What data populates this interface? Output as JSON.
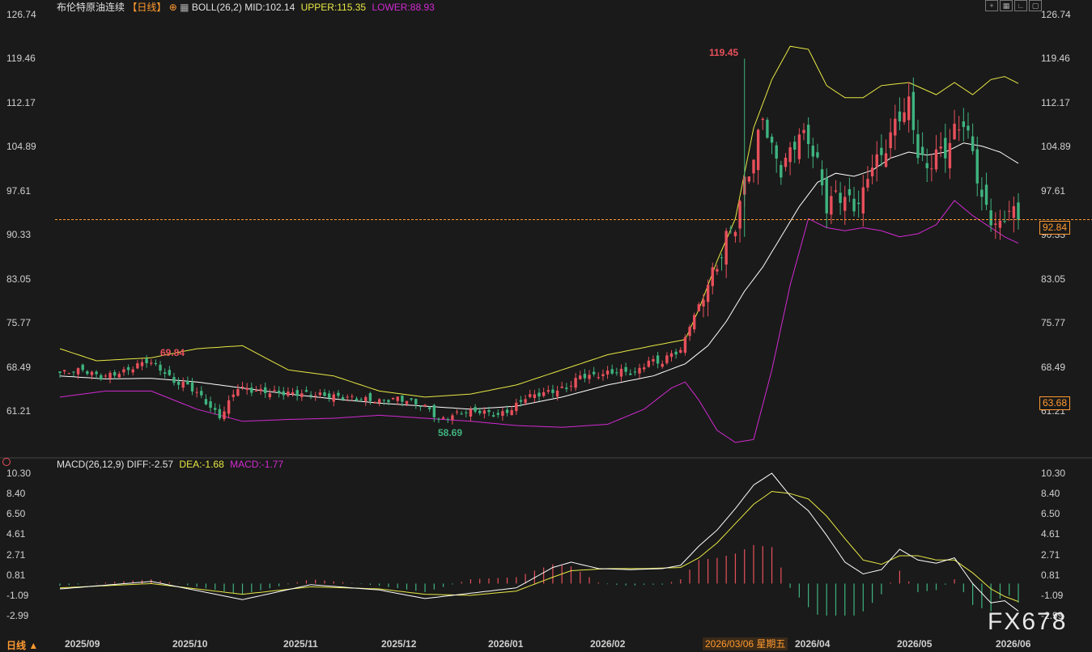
{
  "header": {
    "symbol": "布伦特原油连续",
    "period": "【日线】",
    "indicator": "BOLL(26,2)",
    "mid": "MID:102.14",
    "upper": "UPPER:115.35",
    "lower": "LOWER:88.93"
  },
  "macd_header": {
    "name": "MACD(26,12,9)",
    "diff": "DIFF:-2.57",
    "dea": "DEA:-1.68",
    "macd": "MACD:-1.77"
  },
  "bottom_label": "日线 ▲",
  "watermark": "FX678",
  "current_price_label": "92.84",
  "crosshair_price_label": "63.68",
  "crosshair_date_label": "2026/03/06 星期五",
  "annotations": {
    "high": "119.45",
    "mid_high": "69.84",
    "low": "58.69"
  },
  "colors": {
    "up": "#e8505b",
    "down": "#3fb37f",
    "upper": "#e8e845",
    "mid": "#ffffff",
    "lower": "#d22ad2",
    "dea": "#e8e845",
    "diff": "#ffffff",
    "price_line": "#ff9a30"
  },
  "price_ticks": [
    "126.74",
    "119.46",
    "112.17",
    "104.89",
    "97.61",
    "90.33",
    "83.05",
    "75.77",
    "68.49",
    "61.21"
  ],
  "macd_ticks": [
    "10.30",
    "8.40",
    "6.50",
    "4.61",
    "2.71",
    "0.81",
    "-1.09",
    "-2.99"
  ],
  "x_labels": [
    "2025/09",
    "2025/10",
    "2025/11",
    "2025/12",
    "2026/01",
    "2026/02",
    "2026/04",
    "2026/05",
    "2026/06"
  ],
  "chart_data": [
    {
      "type": "candlestick",
      "title": "布伦特原油连续",
      "ylim": [
        54.0,
        126.74
      ],
      "current_price": 92.84,
      "annotations": {
        "high": 119.45,
        "marked_high": 69.84,
        "low": 58.69
      },
      "close_path": [
        [
          0,
          67.5
        ],
        [
          5,
          68.0
        ],
        [
          9,
          66.8
        ],
        [
          14,
          67.7
        ],
        [
          19,
          69.5
        ],
        [
          22,
          68.2
        ],
        [
          25,
          66.0
        ],
        [
          28,
          65.5
        ],
        [
          31,
          63.5
        ],
        [
          33,
          61.8
        ],
        [
          35,
          60.2
        ],
        [
          37,
          62.6
        ],
        [
          39,
          65.2
        ],
        [
          42,
          64.6
        ],
        [
          48,
          64.2
        ],
        [
          55,
          64.0
        ],
        [
          62,
          63.5
        ],
        [
          66,
          63.2
        ],
        [
          70,
          62.8
        ],
        [
          74,
          63.3
        ],
        [
          78,
          62.5
        ],
        [
          81,
          61.5
        ],
        [
          83,
          59.6
        ],
        [
          85,
          60.2
        ],
        [
          88,
          61.0
        ],
        [
          92,
          61.2
        ],
        [
          96,
          60.5
        ],
        [
          99,
          61.5
        ],
        [
          102,
          63.5
        ],
        [
          105,
          64.0
        ],
        [
          108,
          64.5
        ],
        [
          111,
          65.0
        ],
        [
          114,
          67.0
        ],
        [
          117,
          67.0
        ],
        [
          120,
          67.5
        ],
        [
          123,
          67.8
        ],
        [
          126,
          67.4
        ],
        [
          129,
          69.5
        ],
        [
          132,
          69.2
        ],
        [
          134,
          70.8
        ],
        [
          136,
          71.0
        ],
        [
          138,
          75.5
        ],
        [
          140,
          78.5
        ],
        [
          142,
          82.5
        ],
        [
          144,
          85.0
        ],
        [
          146,
          90.0
        ],
        [
          148,
          92.0
        ],
        [
          150,
          99.0
        ],
        [
          152,
          103.0
        ],
        [
          154,
          110.0
        ],
        [
          156,
          104.5
        ],
        [
          158,
          101.0
        ],
        [
          160,
          104.0
        ],
        [
          162,
          107.0
        ],
        [
          164,
          106.0
        ],
        [
          166,
          102.0
        ],
        [
          168,
          95.0
        ],
        [
          170,
          97.0
        ],
        [
          172,
          96.5
        ],
        [
          174,
          95.0
        ],
        [
          176,
          97.0
        ],
        [
          178,
          102.5
        ],
        [
          180,
          103.0
        ],
        [
          182,
          107.0
        ],
        [
          184,
          110.0
        ],
        [
          186,
          112.0
        ],
        [
          188,
          104.0
        ],
        [
          190,
          101.0
        ],
        [
          192,
          104.0
        ],
        [
          194,
          104.0
        ],
        [
          196,
          107.5
        ],
        [
          198,
          109.0
        ],
        [
          200,
          104.0
        ],
        [
          202,
          96.0
        ],
        [
          204,
          93.0
        ],
        [
          206,
          91.5
        ],
        [
          208,
          95.0
        ],
        [
          210,
          92.84
        ]
      ],
      "bands_path": {
        "upper": [
          [
            0,
            71.5
          ],
          [
            8,
            69.5
          ],
          [
            20,
            70.0
          ],
          [
            30,
            71.5
          ],
          [
            40,
            72.0
          ],
          [
            50,
            68.0
          ],
          [
            60,
            67.0
          ],
          [
            70,
            64.5
          ],
          [
            80,
            63.5
          ],
          [
            90,
            64.0
          ],
          [
            100,
            65.5
          ],
          [
            110,
            68.0
          ],
          [
            120,
            70.5
          ],
          [
            130,
            72.0
          ],
          [
            137,
            73.0
          ],
          [
            140,
            78.0
          ],
          [
            144,
            86.0
          ],
          [
            148,
            93.0
          ],
          [
            152,
            108.0
          ],
          [
            156,
            116.0
          ],
          [
            160,
            121.5
          ],
          [
            164,
            121.0
          ],
          [
            168,
            115.0
          ],
          [
            172,
            113.0
          ],
          [
            176,
            113.0
          ],
          [
            180,
            115.0
          ],
          [
            186,
            115.5
          ],
          [
            192,
            113.5
          ],
          [
            196,
            115.5
          ],
          [
            200,
            113.5
          ],
          [
            204,
            116.0
          ],
          [
            207,
            116.5
          ],
          [
            210,
            115.35
          ]
        ],
        "mid": [
          [
            0,
            67.0
          ],
          [
            10,
            66.5
          ],
          [
            20,
            66.6
          ],
          [
            30,
            66.0
          ],
          [
            40,
            65.0
          ],
          [
            50,
            64.0
          ],
          [
            60,
            63.2
          ],
          [
            70,
            62.5
          ],
          [
            80,
            62.0
          ],
          [
            90,
            61.5
          ],
          [
            100,
            62.0
          ],
          [
            110,
            63.5
          ],
          [
            120,
            65.5
          ],
          [
            130,
            67.0
          ],
          [
            137,
            69.0
          ],
          [
            142,
            72.0
          ],
          [
            146,
            76.0
          ],
          [
            150,
            81.0
          ],
          [
            154,
            85.0
          ],
          [
            158,
            90.0
          ],
          [
            162,
            95.0
          ],
          [
            166,
            99.0
          ],
          [
            170,
            100.5
          ],
          [
            174,
            100.0
          ],
          [
            178,
            101.0
          ],
          [
            182,
            103.0
          ],
          [
            186,
            104.0
          ],
          [
            190,
            103.5
          ],
          [
            194,
            104.0
          ],
          [
            198,
            105.5
          ],
          [
            202,
            105.0
          ],
          [
            206,
            104.0
          ],
          [
            210,
            102.14
          ]
        ],
        "lower": [
          [
            0,
            63.5
          ],
          [
            10,
            64.5
          ],
          [
            20,
            64.5
          ],
          [
            30,
            61.5
          ],
          [
            40,
            59.5
          ],
          [
            50,
            59.8
          ],
          [
            60,
            60.0
          ],
          [
            70,
            60.5
          ],
          [
            80,
            60.0
          ],
          [
            90,
            59.5
          ],
          [
            100,
            58.8
          ],
          [
            110,
            58.5
          ],
          [
            120,
            59.0
          ],
          [
            128,
            61.5
          ],
          [
            134,
            65.0
          ],
          [
            137,
            66.0
          ],
          [
            140,
            63.0
          ],
          [
            144,
            58.0
          ],
          [
            148,
            56.0
          ],
          [
            152,
            56.5
          ],
          [
            156,
            68.0
          ],
          [
            160,
            82.0
          ],
          [
            164,
            93.0
          ],
          [
            168,
            91.5
          ],
          [
            172,
            91.0
          ],
          [
            176,
            91.5
          ],
          [
            180,
            91.0
          ],
          [
            184,
            90.0
          ],
          [
            188,
            90.5
          ],
          [
            192,
            92.0
          ],
          [
            196,
            96.0
          ],
          [
            200,
            93.5
          ],
          [
            204,
            91.5
          ],
          [
            207,
            90.0
          ],
          [
            210,
            88.93
          ]
        ]
      }
    },
    {
      "type": "macd",
      "title": "MACD(26,12,9)",
      "ylim": [
        -3.6,
        10.3
      ],
      "diff": [
        [
          0,
          -0.5
        ],
        [
          20,
          0.2
        ],
        [
          40,
          -1.5
        ],
        [
          55,
          -0.1
        ],
        [
          70,
          -0.6
        ],
        [
          80,
          -1.4
        ],
        [
          90,
          -0.9
        ],
        [
          100,
          -0.4
        ],
        [
          108,
          1.5
        ],
        [
          112,
          2.0
        ],
        [
          118,
          1.4
        ],
        [
          125,
          1.3
        ],
        [
          132,
          1.4
        ],
        [
          136,
          1.7
        ],
        [
          140,
          3.5
        ],
        [
          144,
          5.0
        ],
        [
          148,
          7.0
        ],
        [
          152,
          9.2
        ],
        [
          156,
          10.3
        ],
        [
          160,
          8.2
        ],
        [
          164,
          6.8
        ],
        [
          168,
          4.5
        ],
        [
          172,
          2.0
        ],
        [
          176,
          0.9
        ],
        [
          180,
          1.3
        ],
        [
          184,
          3.2
        ],
        [
          188,
          2.2
        ],
        [
          192,
          1.9
        ],
        [
          196,
          2.4
        ],
        [
          200,
          0.0
        ],
        [
          204,
          -1.8
        ],
        [
          207,
          -1.6
        ],
        [
          210,
          -2.57
        ]
      ],
      "dea": [
        [
          0,
          -0.4
        ],
        [
          20,
          0.0
        ],
        [
          40,
          -1.0
        ],
        [
          55,
          -0.3
        ],
        [
          70,
          -0.5
        ],
        [
          80,
          -1.0
        ],
        [
          90,
          -1.1
        ],
        [
          100,
          -0.7
        ],
        [
          108,
          0.6
        ],
        [
          112,
          1.2
        ],
        [
          120,
          1.4
        ],
        [
          128,
          1.4
        ],
        [
          136,
          1.5
        ],
        [
          140,
          2.4
        ],
        [
          144,
          3.8
        ],
        [
          148,
          5.6
        ],
        [
          152,
          7.4
        ],
        [
          156,
          8.6
        ],
        [
          160,
          8.4
        ],
        [
          164,
          7.9
        ],
        [
          168,
          6.3
        ],
        [
          172,
          4.2
        ],
        [
          176,
          2.2
        ],
        [
          180,
          1.8
        ],
        [
          184,
          2.6
        ],
        [
          188,
          2.6
        ],
        [
          192,
          2.2
        ],
        [
          196,
          2.2
        ],
        [
          200,
          1.0
        ],
        [
          204,
          -0.5
        ],
        [
          207,
          -1.2
        ],
        [
          210,
          -1.68
        ]
      ],
      "macd_hist_note": "bars = 2*(DIFF-DEA)",
      "last": {
        "diff": -2.57,
        "dea": -1.68,
        "macd": -1.77
      }
    }
  ]
}
